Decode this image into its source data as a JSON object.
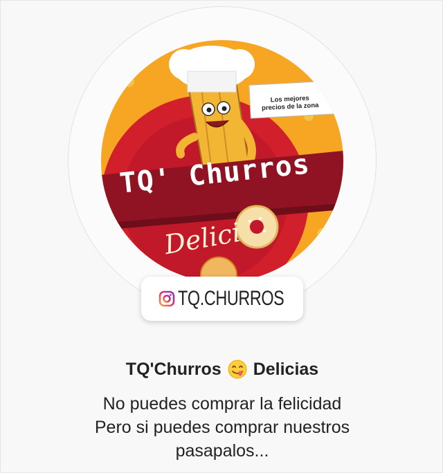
{
  "profile": {
    "avatar": {
      "badge_text_line1": "Los mejores",
      "badge_text_line2": "precios de la zona",
      "brand_text": "TQ' Churros",
      "script_text": "Delici"
    },
    "handle": {
      "icon": "instagram-icon",
      "text": "TQ.CHURROS"
    },
    "name": {
      "part1": "TQ'Churros",
      "emoji": "yum-face-emoji",
      "part2": "Delicias"
    },
    "bio": {
      "line1": "No puedes comprar la felicidad",
      "line2": "Pero si puedes comprar nuestros",
      "line3": "pasapalos..."
    }
  },
  "colors": {
    "orange": "#f4a722",
    "red": "#c7172b",
    "dark_red": "#8f1322",
    "text": "#222222"
  }
}
